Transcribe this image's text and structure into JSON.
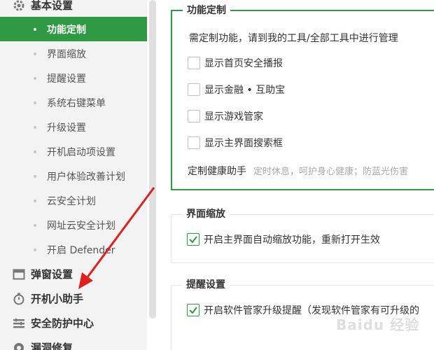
{
  "sidebar": {
    "group_basic": {
      "label": "基本设置",
      "icon": "gear-icon"
    },
    "sub_items": [
      {
        "label": "功能定制",
        "active": true
      },
      {
        "label": "界面缩放",
        "active": false
      },
      {
        "label": "提醒设置",
        "active": false
      },
      {
        "label": "系统右键菜单",
        "active": false
      },
      {
        "label": "升级设置",
        "active": false
      },
      {
        "label": "开机启动项设置",
        "active": false
      },
      {
        "label": "用户体验改善计划",
        "active": false
      },
      {
        "label": "云安全计划",
        "active": false
      },
      {
        "label": "网址云安全计划",
        "active": false
      },
      {
        "label": "开启 Defender",
        "active": false
      }
    ],
    "groups": [
      {
        "label": "弹窗设置",
        "icon": "window-icon"
      },
      {
        "label": "开机小助手",
        "icon": "timer-icon"
      },
      {
        "label": "安全防护中心",
        "icon": "shield-bars-icon"
      },
      {
        "label": "漏洞修复",
        "icon": "repair-icon"
      }
    ]
  },
  "main": {
    "feature_custom": {
      "title": "功能定制",
      "note": "需定制功能，请到我的工具/全部工具中进行管理",
      "options": [
        {
          "label": "显示首页安全播报",
          "checked": false
        },
        {
          "label": "显示金融 • 互助宝",
          "checked": false
        },
        {
          "label": "显示游戏管家",
          "checked": false
        },
        {
          "label": "显示主界面搜索框",
          "checked": false
        }
      ],
      "helper_label": "定制健康助手",
      "helper_desc": "定时休息，呵护身心健康；防蓝光伤害"
    },
    "zoom": {
      "title": "界面缩放",
      "option": {
        "label": "开启主界面自动缩放功能，重新打开生效",
        "checked": true
      }
    },
    "reminder": {
      "title": "提醒设置",
      "option": {
        "label": "开启软件管家升级提醒（发现软件管家有可升级的",
        "checked": true
      }
    }
  },
  "colors": {
    "accent": "#2f9a43",
    "annotation_arrow": "#e02020"
  },
  "watermark": "Baidu 经验"
}
